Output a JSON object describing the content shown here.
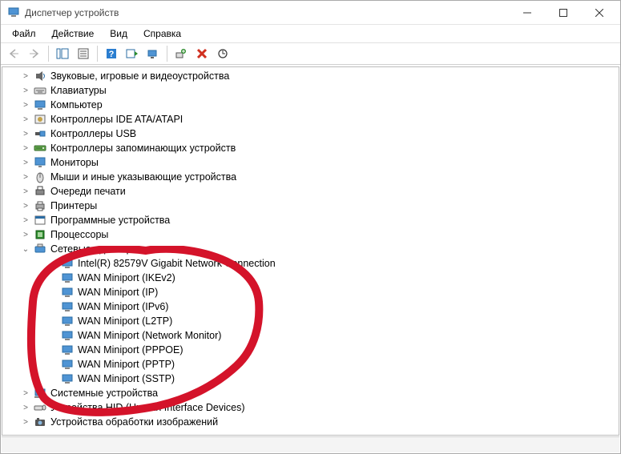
{
  "window": {
    "title": "Диспетчер устройств"
  },
  "menu": {
    "file": "Файл",
    "action": "Действие",
    "view": "Вид",
    "help": "Справка"
  },
  "tree": {
    "categories": [
      {
        "label": "Звуковые, игровые и видеоустройства",
        "icon": "sound",
        "expanded": false,
        "expandable": true
      },
      {
        "label": "Клавиатуры",
        "icon": "keyboard",
        "expanded": false,
        "expandable": true
      },
      {
        "label": "Компьютер",
        "icon": "computer",
        "expanded": false,
        "expandable": true
      },
      {
        "label": "Контроллеры IDE ATA/ATAPI",
        "icon": "ide",
        "expanded": false,
        "expandable": true
      },
      {
        "label": "Контроллеры USB",
        "icon": "usb",
        "expanded": false,
        "expandable": true
      },
      {
        "label": "Контроллеры запоминающих устройств",
        "icon": "storage",
        "expanded": false,
        "expandable": true
      },
      {
        "label": "Мониторы",
        "icon": "monitor",
        "expanded": false,
        "expandable": true
      },
      {
        "label": "Мыши и иные указывающие устройства",
        "icon": "mouse",
        "expanded": false,
        "expandable": true
      },
      {
        "label": "Очереди печати",
        "icon": "printqueue",
        "expanded": false,
        "expandable": true
      },
      {
        "label": "Принтеры",
        "icon": "printer",
        "expanded": false,
        "expandable": true
      },
      {
        "label": "Программные устройства",
        "icon": "software",
        "expanded": false,
        "expandable": true
      },
      {
        "label": "Процессоры",
        "icon": "cpu",
        "expanded": false,
        "expandable": true
      },
      {
        "label": "Сетевые адаптеры",
        "icon": "network",
        "expanded": true,
        "expandable": true,
        "children": [
          {
            "label": "Intel(R) 82579V Gigabit Network Connection",
            "icon": "netadapter"
          },
          {
            "label": "WAN Miniport (IKEv2)",
            "icon": "netadapter"
          },
          {
            "label": "WAN Miniport (IP)",
            "icon": "netadapter"
          },
          {
            "label": "WAN Miniport (IPv6)",
            "icon": "netadapter"
          },
          {
            "label": "WAN Miniport (L2TP)",
            "icon": "netadapter"
          },
          {
            "label": "WAN Miniport (Network Monitor)",
            "icon": "netadapter"
          },
          {
            "label": "WAN Miniport (PPPOE)",
            "icon": "netadapter"
          },
          {
            "label": "WAN Miniport (PPTP)",
            "icon": "netadapter"
          },
          {
            "label": "WAN Miniport (SSTP)",
            "icon": "netadapter"
          }
        ]
      },
      {
        "label": "Системные устройства",
        "icon": "system",
        "expanded": false,
        "expandable": true
      },
      {
        "label": "Устройства HID (Human Interface Devices)",
        "icon": "hid",
        "expanded": false,
        "expandable": true
      },
      {
        "label": "Устройства обработки изображений",
        "icon": "imaging",
        "expanded": false,
        "expandable": true
      }
    ]
  },
  "glyphs": {
    "expander_collapsed": ">",
    "expander_expanded": "⌄"
  }
}
